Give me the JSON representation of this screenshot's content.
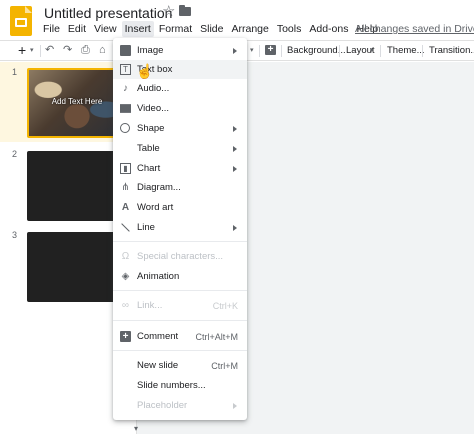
{
  "header": {
    "title": "Untitled presentation",
    "saved_status": "All changes saved in Drive"
  },
  "menubar": {
    "items": [
      "File",
      "Edit",
      "View",
      "Insert",
      "Format",
      "Slide",
      "Arrange",
      "Tools",
      "Add-ons",
      "Help"
    ],
    "active": "Insert"
  },
  "toolbar": {
    "new_symbol": "+",
    "background_label": "Background...",
    "layout_label": "Layout",
    "theme_label": "Theme...",
    "transition_label": "Transition..."
  },
  "filmstrip": {
    "slides": [
      {
        "number": "1",
        "caption": "Add Text Here"
      },
      {
        "number": "2"
      },
      {
        "number": "3"
      }
    ]
  },
  "insert_menu": {
    "items": [
      {
        "label": "Image",
        "icon": "image-icon",
        "submenu": true
      },
      {
        "label": "Text box",
        "icon": "textbox-icon",
        "hover": true
      },
      {
        "label": "Audio...",
        "icon": "audio-icon"
      },
      {
        "label": "Video...",
        "icon": "video-icon"
      },
      {
        "label": "Shape",
        "icon": "shape-icon",
        "submenu": true
      },
      {
        "label": "Table",
        "submenu": true
      },
      {
        "label": "Chart",
        "icon": "chart-icon",
        "submenu": true
      },
      {
        "label": "Diagram...",
        "icon": "diagram-icon"
      },
      {
        "label": "Word art",
        "icon": "word-art-icon"
      },
      {
        "label": "Line",
        "icon": "line-icon",
        "submenu": true
      },
      {
        "label": "Special characters...",
        "icon": "omega-icon",
        "disabled": true
      },
      {
        "label": "Animation",
        "icon": "animation-icon"
      },
      {
        "label": "Link...",
        "icon": "link-icon",
        "shortcut": "Ctrl+K",
        "disabled": true
      },
      {
        "label": "Comment",
        "icon": "comment-icon",
        "shortcut": "Ctrl+Alt+M"
      },
      {
        "label": "New slide",
        "shortcut": "Ctrl+M"
      },
      {
        "label": "Slide numbers..."
      },
      {
        "label": "Placeholder",
        "submenu": true,
        "disabled": true
      }
    ]
  }
}
